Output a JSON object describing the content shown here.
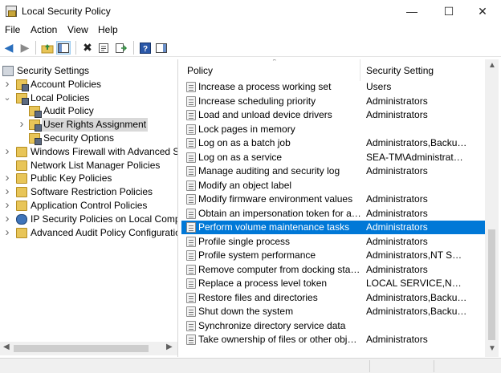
{
  "window": {
    "title": "Local Security Policy",
    "minimize": "—",
    "maximize": "☐",
    "close": "✕"
  },
  "menu": [
    "File",
    "Action",
    "View",
    "Help"
  ],
  "tree": [
    {
      "label": "Security Settings",
      "level": 0,
      "icon": "security-settings-icon",
      "expander": "none"
    },
    {
      "label": "Account Policies",
      "level": 1,
      "icon": "folder-lock-icon",
      "expander": "collapsed"
    },
    {
      "label": "Local Policies",
      "level": 1,
      "icon": "folder-lock-icon",
      "expander": "expanded"
    },
    {
      "label": "Audit Policy",
      "level": 2,
      "icon": "folder-lock-icon",
      "expander": "none"
    },
    {
      "label": "User Rights Assignment",
      "level": 2,
      "icon": "folder-lock-icon",
      "expander": "collapsed",
      "selected": true
    },
    {
      "label": "Security Options",
      "level": 2,
      "icon": "folder-lock-icon",
      "expander": "none"
    },
    {
      "label": "Windows Firewall with Advanced Secu",
      "level": 1,
      "icon": "folder-icon",
      "expander": "collapsed"
    },
    {
      "label": "Network List Manager Policies",
      "level": 1,
      "icon": "folder-icon",
      "expander": "none"
    },
    {
      "label": "Public Key Policies",
      "level": 1,
      "icon": "folder-icon",
      "expander": "collapsed"
    },
    {
      "label": "Software Restriction Policies",
      "level": 1,
      "icon": "folder-icon",
      "expander": "collapsed"
    },
    {
      "label": "Application Control Policies",
      "level": 1,
      "icon": "folder-icon",
      "expander": "collapsed"
    },
    {
      "label": "IP Security Policies on Local Compute",
      "level": 1,
      "icon": "ip-security-icon",
      "expander": "collapsed"
    },
    {
      "label": "Advanced Audit Policy Configuration",
      "level": 1,
      "icon": "folder-icon",
      "expander": "collapsed"
    }
  ],
  "list": {
    "columns": [
      "Policy",
      "Security Setting"
    ],
    "rows": [
      {
        "policy": "Increase a process working set",
        "setting": "Users"
      },
      {
        "policy": "Increase scheduling priority",
        "setting": "Administrators"
      },
      {
        "policy": "Load and unload device drivers",
        "setting": "Administrators"
      },
      {
        "policy": "Lock pages in memory",
        "setting": ""
      },
      {
        "policy": "Log on as a batch job",
        "setting": "Administrators,Backup ..."
      },
      {
        "policy": "Log on as a service",
        "setting": "SEA-TM\\Administrator,..."
      },
      {
        "policy": "Manage auditing and security log",
        "setting": "Administrators"
      },
      {
        "policy": "Modify an object label",
        "setting": ""
      },
      {
        "policy": "Modify firmware environment values",
        "setting": "Administrators"
      },
      {
        "policy": "Obtain an impersonation token for ano...",
        "setting": "Administrators"
      },
      {
        "policy": "Perform volume maintenance tasks",
        "setting": "Administrators",
        "selected": true
      },
      {
        "policy": "Profile single process",
        "setting": "Administrators"
      },
      {
        "policy": "Profile system performance",
        "setting": "Administrators,NT SERVI..."
      },
      {
        "policy": "Remove computer from docking station",
        "setting": "Administrators"
      },
      {
        "policy": "Replace a process level token",
        "setting": "LOCAL SERVICE,NETWO..."
      },
      {
        "policy": "Restore files and directories",
        "setting": "Administrators,Backup ..."
      },
      {
        "policy": "Shut down the system",
        "setting": "Administrators,Backup ..."
      },
      {
        "policy": "Synchronize directory service data",
        "setting": ""
      },
      {
        "policy": "Take ownership of files or other objects",
        "setting": "Administrators"
      }
    ]
  },
  "colors": {
    "selection": "#0078d7",
    "tree_selection": "#d9d9d9"
  }
}
